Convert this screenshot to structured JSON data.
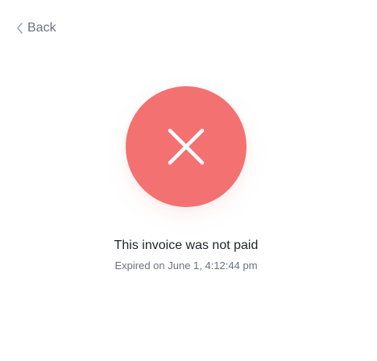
{
  "nav": {
    "back_label": "Back"
  },
  "status": {
    "icon": "close-icon",
    "color": "#f47171",
    "title": "This invoice was not paid",
    "subtitle": "Expired on June 1, 4:12:44 pm"
  },
  "colors": {
    "muted_text": "#6b7280",
    "primary_text": "#1f2328",
    "background": "#ffffff"
  }
}
